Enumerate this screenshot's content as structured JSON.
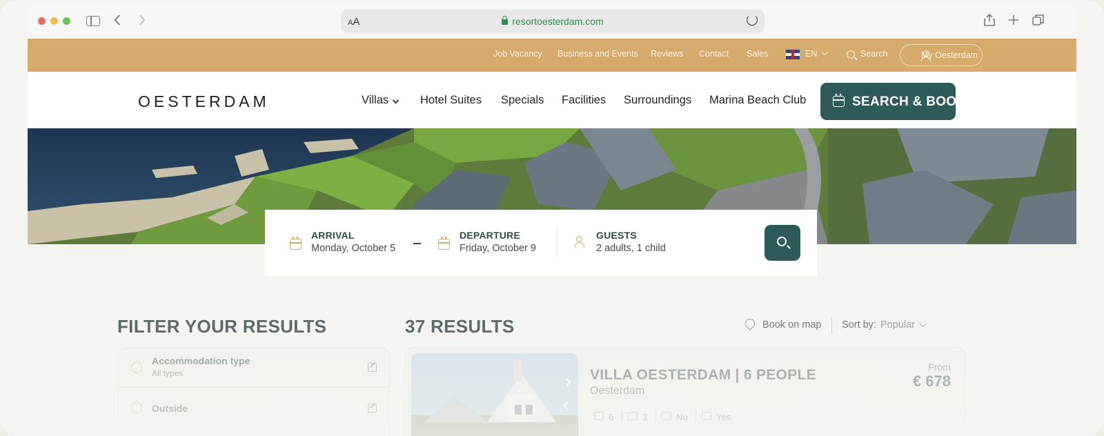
{
  "browser": {
    "aa_label_small": "A",
    "aa_label_big": "A",
    "url": "resortoesterdam.com"
  },
  "topbar": {
    "links": [
      "Job Vacancy",
      "Business and Events",
      "Reviews",
      "Contact",
      "Sales"
    ],
    "language": "EN",
    "search": "Search",
    "account": "My Oesterdam"
  },
  "nav": {
    "logo": "OESTERDAM",
    "items": [
      "Villas",
      "Hotel Suites",
      "Specials",
      "Facilities",
      "Surroundings",
      "Marina Beach Club"
    ],
    "book_button": "SEARCH & BOOK"
  },
  "search": {
    "arrival_label": "ARRIVAL",
    "arrival_value": "Monday, October 5",
    "departure_label": "DEPARTURE",
    "departure_value": "Friday, October 9",
    "guests_label": "GUESTS",
    "guests_value": "2 adults, 1 child"
  },
  "filters": {
    "title": "FILTER YOUR RESULTS",
    "items": [
      {
        "title": "Accommodation type",
        "sub": "All types"
      },
      {
        "title": "Outside",
        "sub": ""
      }
    ]
  },
  "results": {
    "title": "37 RESULTS",
    "map_link": "Book on map",
    "sort_label": "Sort by:",
    "sort_value": "Popular",
    "card": {
      "name": "VILLA OESTERDAM | 6 PEOPLE",
      "location": "Oesterdam",
      "from": "From",
      "price": "€ 678",
      "features": [
        "6",
        "3",
        "No",
        "Yes"
      ]
    }
  },
  "colors": {
    "gold": "#d6aa6d",
    "teal": "#2e5b5a"
  }
}
